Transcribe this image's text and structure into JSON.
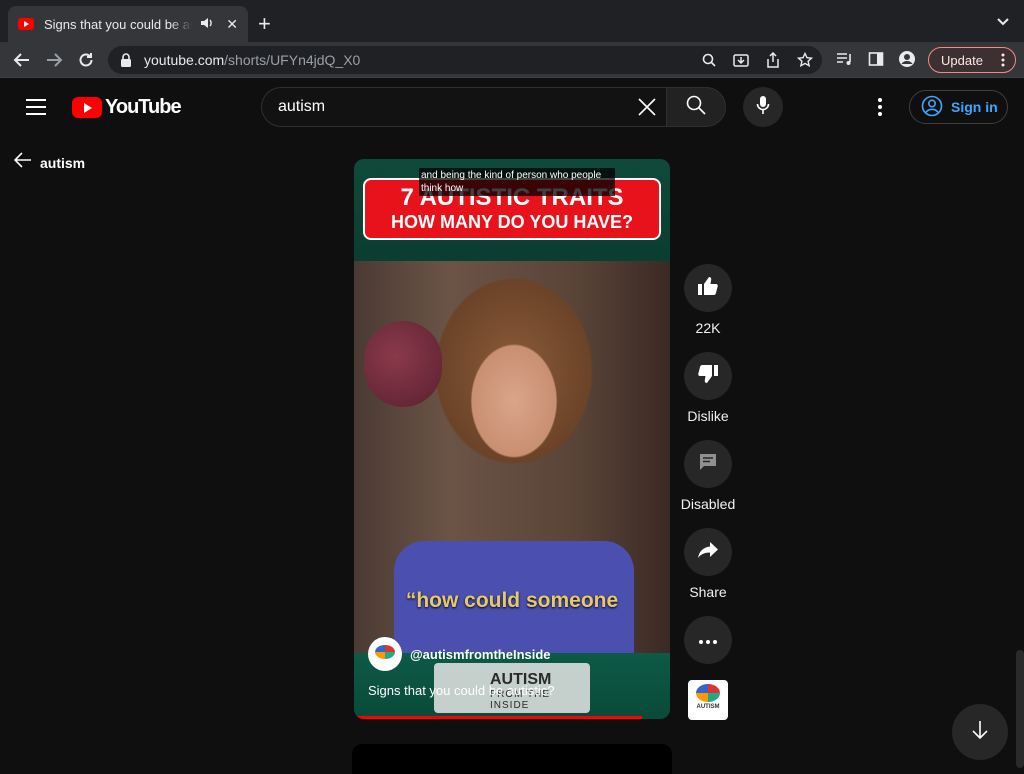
{
  "browser": {
    "tab_title": "Signs that you could be autistic?",
    "url_host": "youtube.com",
    "url_path": "/shorts/UFYn4jdQ_X0",
    "update_label": "Update"
  },
  "header": {
    "logo_text": "YouTube",
    "search_value": "autism",
    "signin_label": "Sign in"
  },
  "back": {
    "label": "autism"
  },
  "video": {
    "caption": "and being the kind of person who people think how",
    "banner_line1": "7 AUTISTIC TRAITS",
    "banner_line2": "HOW MANY DO YOU HAVE?",
    "quote": "“how could someone",
    "logo_text": "AUTISM",
    "logo_sub": "FROM THE INSIDE",
    "channel_handle": "@autismfromtheInside",
    "title": "Signs that you could be autistic?",
    "progress_fraction": 0.91
  },
  "actions": {
    "like_count": "22K",
    "dislike_label": "Dislike",
    "comments_label": "Disabled",
    "share_label": "Share"
  },
  "channel_thumb_text": "AUTISM",
  "colors": {
    "yt_red": "#ff0000",
    "link_blue": "#3ea6ff",
    "background": "#0f0f0f"
  }
}
